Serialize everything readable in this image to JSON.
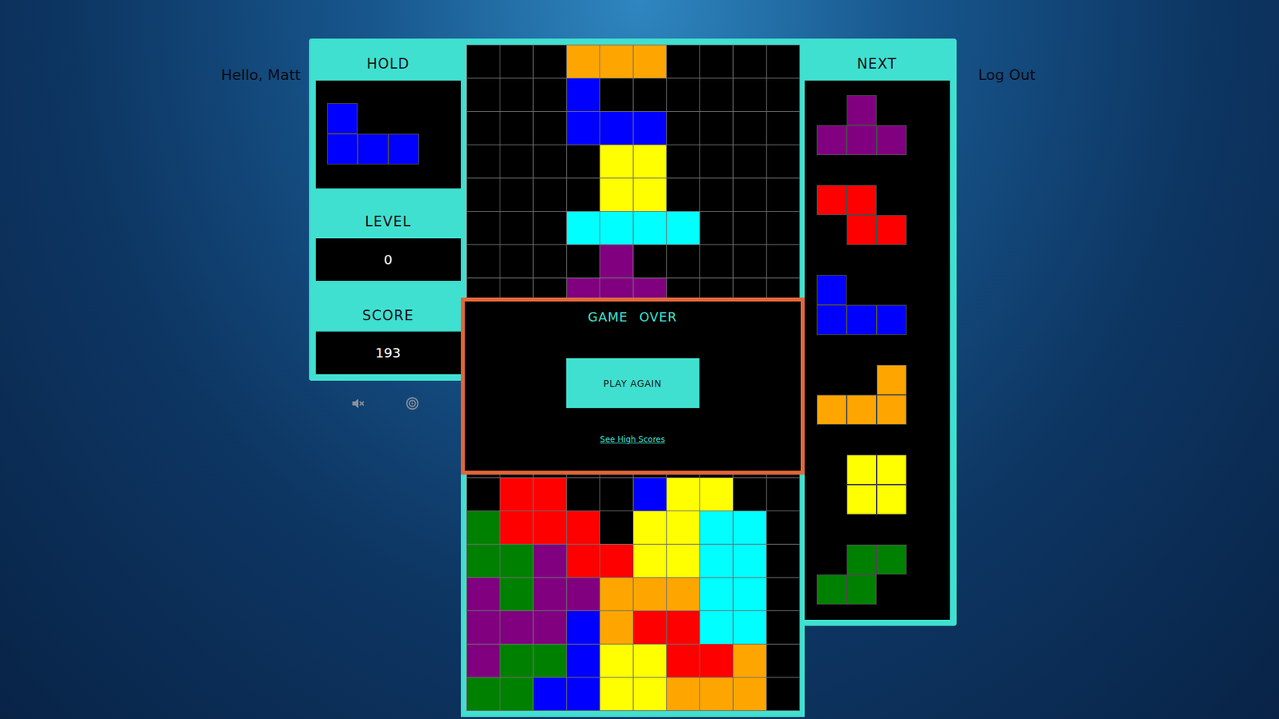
{
  "user": {
    "greeting": "Hello, Matt",
    "logout": "Log Out"
  },
  "hold": {
    "label": "HOLD",
    "piece": [
      "B..",
      "BBB"
    ]
  },
  "level": {
    "label": "LEVEL",
    "value": "0"
  },
  "score": {
    "label": "SCORE",
    "value": "193"
  },
  "sound": {
    "muted": true
  },
  "next": {
    "label": "NEXT",
    "pieces": [
      [
        ".P.",
        "PPP"
      ],
      [
        "RR.",
        ".RR"
      ],
      [
        "B..",
        "BBB"
      ],
      [
        "..O",
        "OOO"
      ],
      [
        ".YY",
        ".YY"
      ],
      [
        ".GG",
        "GG."
      ]
    ]
  },
  "piece_colors": {
    "O": "#ffa500",
    "B": "#0000ff",
    "Y": "#ffff00",
    "C": "#00ffff",
    "P": "#800080",
    "R": "#ff0000",
    "G": "#008000"
  },
  "board": {
    "rows": [
      "...OOO....",
      "...B......",
      "...BBB....",
      "....YY....",
      "....YY....",
      "...CCCC...",
      "....P.....",
      "...PPP....",
      "..........",
      "..........",
      "..........",
      "..........",
      "..........",
      ".RR..BYY..",
      "GRRR.YYCC.",
      "GGPRRYYCC.",
      "PGPPOOOCC.",
      "PPPBORRCC.",
      "PGGBYYRRO.",
      "GGBBYYOOO."
    ]
  },
  "game_over": {
    "title": "GAME OVER",
    "button": "PLAY AGAIN",
    "link": "See High Scores"
  }
}
